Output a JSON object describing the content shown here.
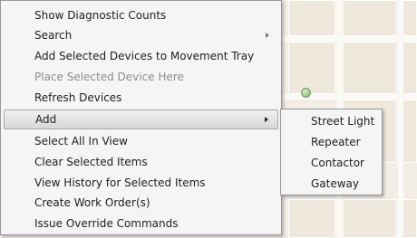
{
  "context_menu": {
    "items": [
      {
        "label": "Show Diagnostic Counts"
      },
      {
        "label": "Search"
      },
      {
        "label": "Add Selected Devices to Movement Tray"
      },
      {
        "label": "Place Selected Device Here"
      },
      {
        "label": "Refresh Devices"
      },
      {
        "label": "Add"
      },
      {
        "label": "Select All In View"
      },
      {
        "label": "Clear Selected Items"
      },
      {
        "label": "View History for Selected Items"
      },
      {
        "label": "Create Work Order(s)"
      },
      {
        "label": "Issue Override Commands"
      }
    ]
  },
  "add_submenu": {
    "items": [
      {
        "label": "Street Light"
      },
      {
        "label": "Repeater"
      },
      {
        "label": "Contactor"
      },
      {
        "label": "Gateway"
      }
    ]
  },
  "colors": {
    "menu_background": "#f5f5f5",
    "highlight": "#d7d7d7",
    "disabled_text": "#8d8d8d",
    "map_background": "#f3eee5",
    "device_marker": "#9ad18a"
  }
}
